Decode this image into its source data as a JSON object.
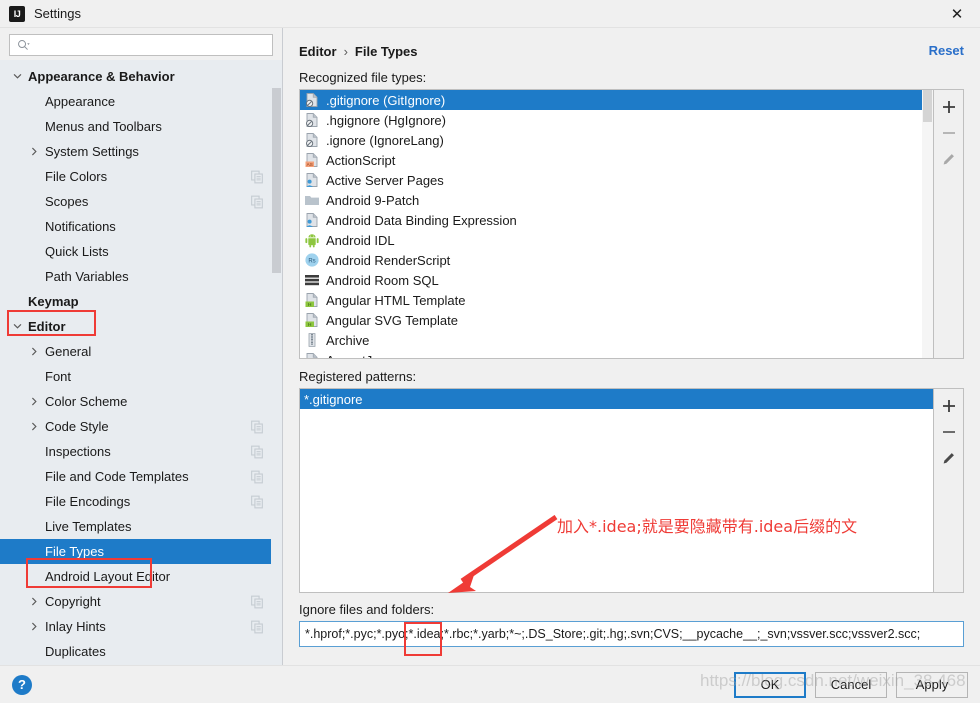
{
  "window": {
    "title": "Settings",
    "logo_icon": "intellij-idea-logo",
    "close_icon": "close-icon"
  },
  "search": {
    "placeholder": "",
    "value": "",
    "icon": "search-icon"
  },
  "sidebar": {
    "scroll_icon": "scrollbar-thumb",
    "items": [
      {
        "label": "Appearance & Behavior",
        "level": 0,
        "arrow": "chevron-down-icon",
        "bold": true,
        "selected": false,
        "copy": false
      },
      {
        "label": "Appearance",
        "level": 1,
        "arrow": "",
        "bold": false,
        "selected": false,
        "copy": false
      },
      {
        "label": "Menus and Toolbars",
        "level": 1,
        "arrow": "",
        "bold": false,
        "selected": false,
        "copy": false
      },
      {
        "label": "System Settings",
        "level": 1,
        "arrow": "chevron-right-icon",
        "bold": false,
        "selected": false,
        "copy": false
      },
      {
        "label": "File Colors",
        "level": 1,
        "arrow": "",
        "bold": false,
        "selected": false,
        "copy": true
      },
      {
        "label": "Scopes",
        "level": 1,
        "arrow": "",
        "bold": false,
        "selected": false,
        "copy": true
      },
      {
        "label": "Notifications",
        "level": 1,
        "arrow": "",
        "bold": false,
        "selected": false,
        "copy": false
      },
      {
        "label": "Quick Lists",
        "level": 1,
        "arrow": "",
        "bold": false,
        "selected": false,
        "copy": false
      },
      {
        "label": "Path Variables",
        "level": 1,
        "arrow": "",
        "bold": false,
        "selected": false,
        "copy": false
      },
      {
        "label": "Keymap",
        "level": 0,
        "arrow": "",
        "bold": true,
        "selected": false,
        "copy": false
      },
      {
        "label": "Editor",
        "level": 0,
        "arrow": "chevron-down-icon",
        "bold": true,
        "selected": false,
        "copy": false
      },
      {
        "label": "General",
        "level": 1,
        "arrow": "chevron-right-icon",
        "bold": false,
        "selected": false,
        "copy": false
      },
      {
        "label": "Font",
        "level": 1,
        "arrow": "",
        "bold": false,
        "selected": false,
        "copy": false
      },
      {
        "label": "Color Scheme",
        "level": 1,
        "arrow": "chevron-right-icon",
        "bold": false,
        "selected": false,
        "copy": false
      },
      {
        "label": "Code Style",
        "level": 1,
        "arrow": "chevron-right-icon",
        "bold": false,
        "selected": false,
        "copy": true
      },
      {
        "label": "Inspections",
        "level": 1,
        "arrow": "",
        "bold": false,
        "selected": false,
        "copy": true
      },
      {
        "label": "File and Code Templates",
        "level": 1,
        "arrow": "",
        "bold": false,
        "selected": false,
        "copy": true
      },
      {
        "label": "File Encodings",
        "level": 1,
        "arrow": "",
        "bold": false,
        "selected": false,
        "copy": true
      },
      {
        "label": "Live Templates",
        "level": 1,
        "arrow": "",
        "bold": false,
        "selected": false,
        "copy": false
      },
      {
        "label": "File Types",
        "level": 1,
        "arrow": "",
        "bold": false,
        "selected": true,
        "copy": false
      },
      {
        "label": "Android Layout Editor",
        "level": 1,
        "arrow": "",
        "bold": false,
        "selected": false,
        "copy": false
      },
      {
        "label": "Copyright",
        "level": 1,
        "arrow": "chevron-right-icon",
        "bold": false,
        "selected": false,
        "copy": true
      },
      {
        "label": "Inlay Hints",
        "level": 1,
        "arrow": "chevron-right-icon",
        "bold": false,
        "selected": false,
        "copy": true
      },
      {
        "label": "Duplicates",
        "level": 1,
        "arrow": "",
        "bold": false,
        "selected": false,
        "copy": false
      }
    ]
  },
  "breadcrumb": {
    "parent": "Editor",
    "separator": "›",
    "current": "File Types"
  },
  "reset": {
    "label": "Reset"
  },
  "recognized": {
    "label": "Recognized file types:",
    "items": [
      {
        "label": ".gitignore (GitIgnore)",
        "icon": "gitignore-file-icon",
        "selected": true
      },
      {
        "label": ".hgignore (HgIgnore)",
        "icon": "hgignore-file-icon",
        "selected": false
      },
      {
        "label": ".ignore (IgnoreLang)",
        "icon": "ignore-file-icon",
        "selected": false
      },
      {
        "label": "ActionScript",
        "icon": "actionscript-icon",
        "selected": false
      },
      {
        "label": "Active Server Pages",
        "icon": "asp-file-icon",
        "selected": false
      },
      {
        "label": "Android 9-Patch",
        "icon": "folder-icon",
        "selected": false
      },
      {
        "label": "Android Data Binding Expression",
        "icon": "asp-file-icon",
        "selected": false
      },
      {
        "label": "Android IDL",
        "icon": "android-robot-icon",
        "selected": false
      },
      {
        "label": "Android RenderScript",
        "icon": "renderscript-icon",
        "selected": false
      },
      {
        "label": "Android Room SQL",
        "icon": "database-table-icon",
        "selected": false
      },
      {
        "label": "Angular HTML Template",
        "icon": "html-template-icon",
        "selected": false
      },
      {
        "label": "Angular SVG Template",
        "icon": "html-template-icon",
        "selected": false
      },
      {
        "label": "Archive",
        "icon": "archive-zip-icon",
        "selected": false
      },
      {
        "label": "AspectJ",
        "icon": "aspectj-file-icon",
        "selected": false
      }
    ],
    "buttons": [
      {
        "name": "add-file-type-button",
        "glyph": "+",
        "icon": "plus-icon"
      },
      {
        "name": "remove-file-type-button",
        "glyph": "−",
        "icon": "minus-icon"
      },
      {
        "name": "edit-file-type-button",
        "glyph": "",
        "icon": "pencil-icon"
      }
    ]
  },
  "patterns": {
    "label": "Registered patterns:",
    "items": [
      {
        "label": "*.gitignore",
        "selected": true
      }
    ],
    "buttons": [
      {
        "name": "add-pattern-button",
        "glyph": "+",
        "icon": "plus-icon"
      },
      {
        "name": "remove-pattern-button",
        "glyph": "−",
        "icon": "minus-icon"
      },
      {
        "name": "edit-pattern-button",
        "glyph": "",
        "icon": "pencil-icon"
      }
    ]
  },
  "ignore": {
    "label": "Ignore files and folders:",
    "value": "*.hprof;*.pyc;*.pyo;*.idea;*.rbc;*.yarb;*~;.DS_Store;.git;.hg;.svn;CVS;__pycache__;_svn;vssver.scc;vssver2.scc;",
    "placeholder": ""
  },
  "annotation": {
    "text": "加入*.idea;就是要隐藏带有.idea后缀的文",
    "color": "#ef3b36",
    "arrow_icon": "red-arrow-icon"
  },
  "footer": {
    "help_glyph": "?",
    "help_icon": "help-icon",
    "ok": "OK",
    "cancel": "Cancel",
    "apply": "Apply"
  },
  "watermark": {
    "text": "https://blog.csdn.net/weixin_38     468"
  },
  "colors": {
    "selection_blue": "#1e7bc8",
    "accent_link": "#2a6fc9",
    "annotation_red": "#ef3b36",
    "sidebar_bg": "#e8ecf0",
    "panel_bg": "#f0f0f0"
  }
}
